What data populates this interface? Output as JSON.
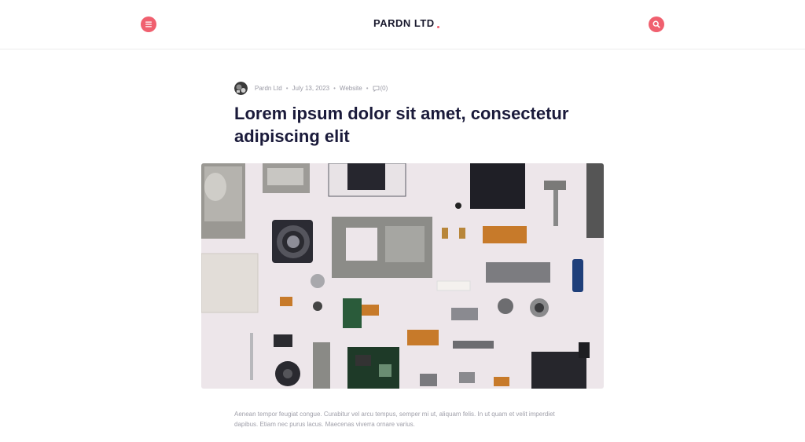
{
  "brand": {
    "name": "PARDN LTD",
    "accent": "#f0606f"
  },
  "header": {
    "menu_icon": "hamburger-menu-icon",
    "search_icon": "search-icon"
  },
  "post": {
    "author": "Pardn Ltd",
    "date": "July 13, 2023",
    "category": "Website",
    "comment_icon": "comment-icon",
    "comments": "(0)",
    "title": "Lorem ipsum dolor sit amet, consectetur adipiscing elit",
    "image": "disassembled-camera-parts-photo",
    "excerpt": "Aenean tempor feugiat congue. Curabitur vel arcu tempus, semper mi ut, aliquam felis. In ut quam et velit imperdiet dapibus. Etiam nec purus lacus. Maecenas viverra ornare varius."
  }
}
